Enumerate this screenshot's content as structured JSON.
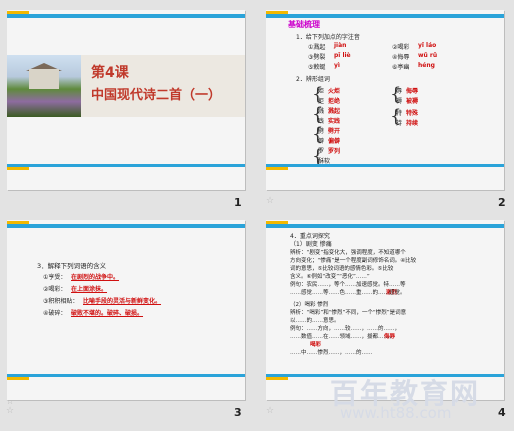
{
  "slides": [
    {
      "number": "1",
      "lesson": "第4课",
      "title": "中国现代诗二首（一）"
    },
    {
      "number": "2",
      "heading": "基础梳理",
      "q1": "1．给下列加点的字注音",
      "items": [
        {
          "label": "①溅起",
          "answer": "jiàn"
        },
        {
          "label": "②喝彩",
          "answer": "yǐ láo"
        },
        {
          "label": "③劈裂",
          "answer": "pī liè"
        },
        {
          "label": "④侮辱",
          "answer": "wǔ rǔ"
        },
        {
          "label": "⑤敕蜒",
          "answer": "yì"
        },
        {
          "label": "⑥亭幽",
          "answer": "héng"
        }
      ],
      "q2": "2．辨形组词",
      "groups": [
        {
          "chars": [
            "炬",
            "拒"
          ],
          "words": [
            "火炬",
            "拒绝"
          ]
        },
        {
          "chars": [
            "溅",
            "践"
          ],
          "words": [
            "溅起",
            "实践"
          ]
        },
        {
          "chars": [
            "辱",
            "褥"
          ],
          "words": [
            "侮辱",
            "被褥"
          ]
        },
        {
          "chars": [
            "劈",
            "僻"
          ],
          "words": [
            "劈开",
            "偏僻"
          ]
        },
        {
          "chars": [
            "罗",
            "萝"
          ],
          "words": [
            "罗列",
            "萝卜"
          ]
        },
        {
          "chars": [
            "稣",
            "酥"
          ],
          "words": [
            "复稣",
            "酥软"
          ]
        },
        {
          "chars": [
            "特",
            "持"
          ],
          "words": [
            "特殊",
            "持续"
          ]
        }
      ]
    },
    {
      "number": "3",
      "heading": "3．解释下列词语的含义",
      "entries": [
        {
          "label": "①亨受：",
          "text": "在剧烈的战争中。"
        },
        {
          "label": "②喝彩：",
          "text": "在上面涂抹。"
        },
        {
          "label": "③积积相贴：",
          "text": "比喻手段的灵活与新鲜变化。"
        },
        {
          "label": "④破碎：",
          "text": "破败不堪的。破碎、破损。"
        }
      ]
    },
    {
      "number": "4",
      "heading": "4．重点词探究",
      "sub1": "（1）剧变  惨痛",
      "lines": [
        "辨析：“剧变”指变化大，强调程度，不知道哪个",
        "方向变化；“惨痛”是一个程度副词修饰名词。④比较",
        "词的意思，⑤比较词语的感情色彩。⑤比较",
        "含义。⑥例如“改变”“恶化”……”",
        "例句：农民……，等个……加速感觉。特……等",
        "……感觉……等……色……重……的……感觉。",
        "（2）喝彩  惨烈",
        "辨析：“喝彩”和“惨烈”不同，一个“惨烈”是词意",
        "以……的……意思。",
        "例句：……方向，……较……，……的……，",
        "……数值……在……领域……，拔都……，",
        "……中……惨烈……，……的……"
      ],
      "highlight1": "激烈",
      "highlight2": "侮辱",
      "highlight3": "喝彩"
    }
  ],
  "watermark": {
    "line1": "百年教育网",
    "line2": "www.ht88.com"
  },
  "colors": {
    "accent_blue": "#2aa3d9",
    "accent_yellow": "#f2b800",
    "answer_red": "#d01010",
    "heading_magenta": "#cc00cc"
  }
}
